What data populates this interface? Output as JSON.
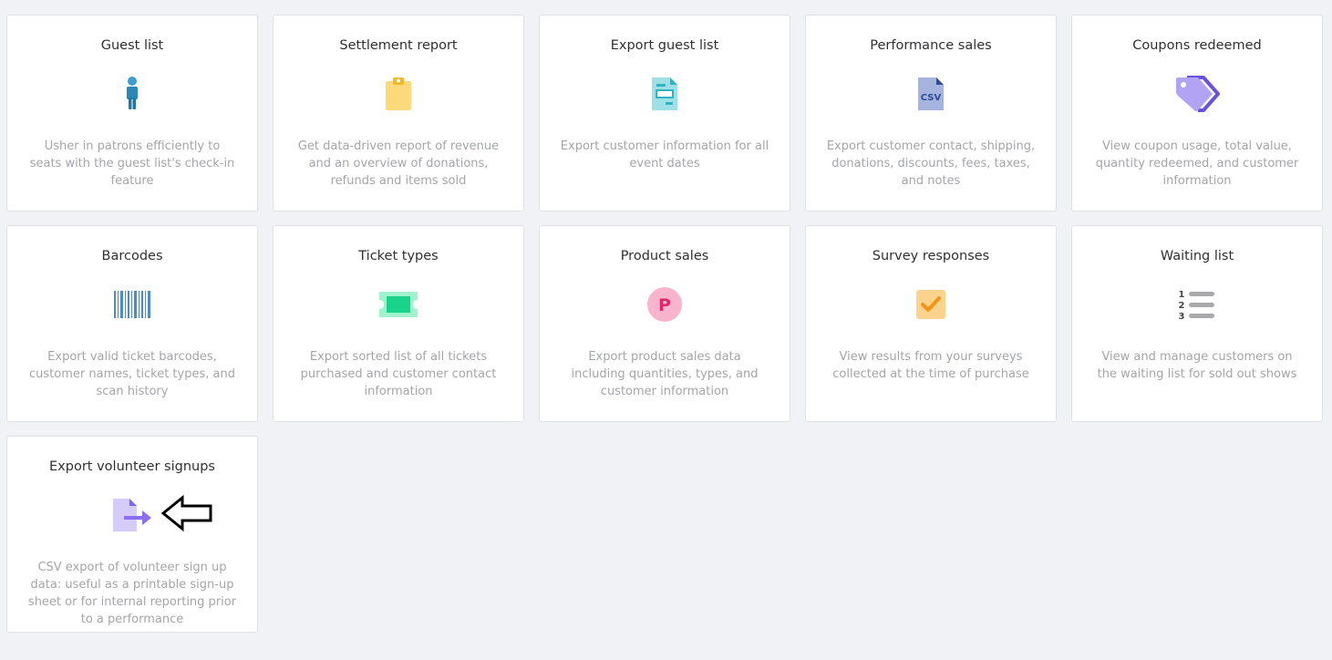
{
  "cards": [
    {
      "title": "Guest list",
      "icon": "person-icon",
      "description": "Usher in patrons efficiently to seats with the guest list's check-in feature"
    },
    {
      "title": "Settlement report",
      "icon": "clipboard-icon",
      "description": "Get data-driven report of revenue and an overview of donations, refunds and items sold"
    },
    {
      "title": "Export guest list",
      "icon": "document-list-icon",
      "description": "Export customer information for all event dates"
    },
    {
      "title": "Performance sales",
      "icon": "csv-file-icon",
      "icon_text": "CSV",
      "description": "Export customer contact, shipping, donations, discounts, fees, taxes, and notes"
    },
    {
      "title": "Coupons redeemed",
      "icon": "tag-icon",
      "description": "View coupon usage, total value, quantity redeemed, and customer information"
    },
    {
      "title": "Barcodes",
      "icon": "barcode-icon",
      "description": "Export valid ticket barcodes, customer names, ticket types, and scan history"
    },
    {
      "title": "Ticket types",
      "icon": "ticket-icon",
      "description": "Export sorted list of all tickets purchased and customer contact information"
    },
    {
      "title": "Product sales",
      "icon": "product-p-icon",
      "icon_text": "P",
      "description": "Export product sales data including quantities, types, and customer information"
    },
    {
      "title": "Survey responses",
      "icon": "checkbox-icon",
      "description": "View results from your surveys collected at the time of purchase"
    },
    {
      "title": "Waiting list",
      "icon": "numbered-list-icon",
      "icon_text": [
        "1",
        "2",
        "3"
      ],
      "description": "View and manage customers on the waiting list for sold out shows"
    },
    {
      "title": "Export volunteer signups",
      "icon": "file-export-icon",
      "description": "CSV export of volunteer sign up data: useful as a printable sign-up sheet or for internal reporting prior to a performance"
    }
  ],
  "colors": {
    "background": "#f1f2f6",
    "card": "#ffffff",
    "title": "#2f3034",
    "description": "#a3a5ab"
  }
}
